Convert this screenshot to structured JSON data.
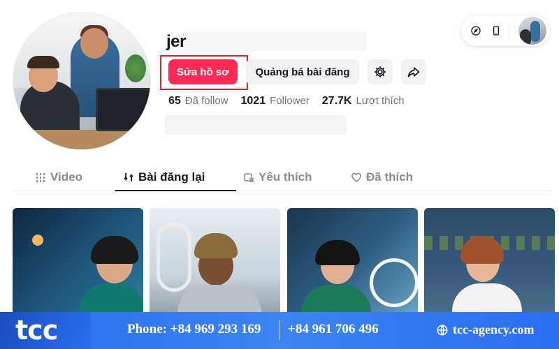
{
  "profile": {
    "username": "jer",
    "buttons": {
      "edit": "Sửa hồ sơ",
      "promote": "Quảng bá bài đăng"
    },
    "stats": [
      {
        "value": "65",
        "label": "Đã follow"
      },
      {
        "value": "1021",
        "label": "Follower"
      },
      {
        "value": "27.7K",
        "label": "Lượt thích"
      }
    ]
  },
  "top_controls": {
    "icons": [
      "compass-icon",
      "phone-icon"
    ]
  },
  "tabs": [
    {
      "label": "Video",
      "icon": "grid-icon",
      "active": false
    },
    {
      "label": "Bài đăng lại",
      "icon": "repost-icon",
      "active": true
    },
    {
      "label": "Yêu thích",
      "icon": "bookmark-icon",
      "active": false
    },
    {
      "label": "Đã thích",
      "icon": "heart-icon",
      "active": false
    }
  ],
  "banner": {
    "logo": "tcc",
    "phone": "Phone: +84 969 293 169",
    "phone2": "+84 961 706 496",
    "website": "tcc-agency.com"
  },
  "colors": {
    "primary": "#fe2c55",
    "highlight": "#e6202f",
    "banner": "#2a6df0"
  }
}
